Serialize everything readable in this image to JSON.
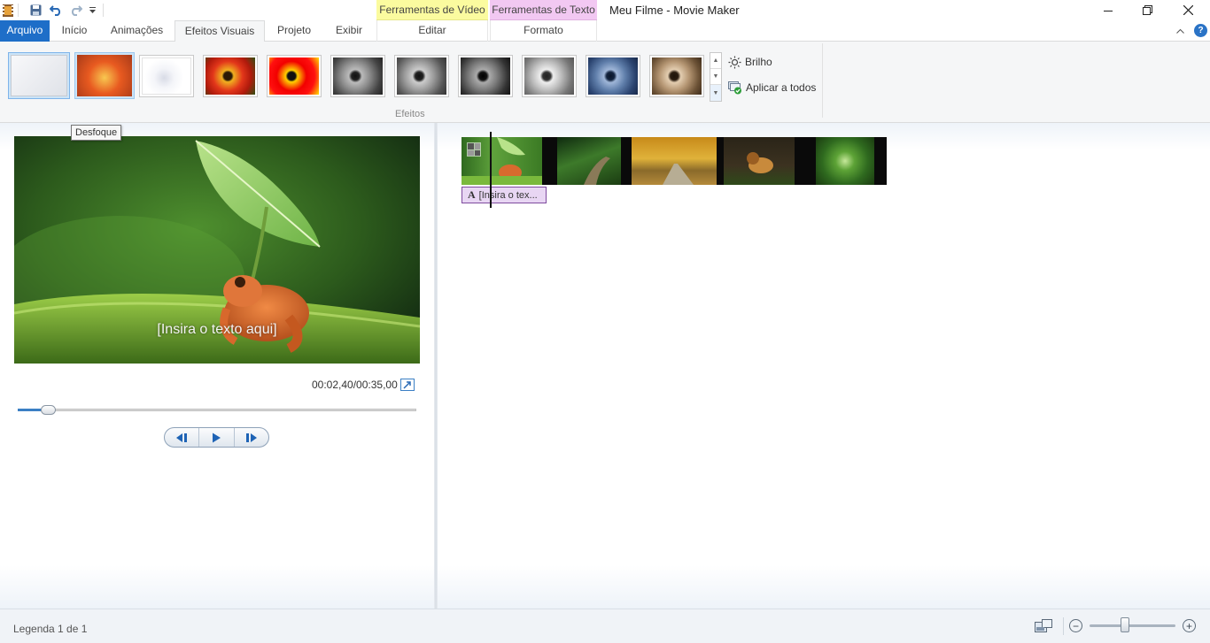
{
  "app": {
    "title": "Meu Filme - Movie Maker"
  },
  "context_tabs": {
    "video_tools": "Ferramentas de Vídeo",
    "text_tools": "Ferramentas de Texto"
  },
  "tabs": [
    {
      "label": "Arquivo"
    },
    {
      "label": "Início"
    },
    {
      "label": "Animações"
    },
    {
      "label": "Efeitos Visuais"
    },
    {
      "label": "Projeto"
    },
    {
      "label": "Exibir"
    },
    {
      "label": "Editar"
    },
    {
      "label": "Formato"
    }
  ],
  "active_tab": "Efeitos Visuais",
  "ribbon": {
    "group_label": "Efeitos",
    "brightness_label": "Brilho",
    "apply_all_label": "Aplicar a todos",
    "selected_effect_index": 0
  },
  "tooltip": "Desfoque",
  "preview": {
    "overlay_text": "[Insira o texto aqui]",
    "timecode": "00:02,40/00:35,00",
    "progress_fraction": 0.069
  },
  "storyboard": {
    "caption_label": "[Insira o tex...",
    "caption_icon": "A"
  },
  "status": {
    "text": "Legenda 1 de 1",
    "zoom_fraction": 0.4
  },
  "colors": {
    "file_tab": "#1e6ec8",
    "video_tools": "#fbfb9f",
    "text_tools": "#f2c8f2",
    "caption_block": "#e8d6f3"
  },
  "icons": [
    "app-icon",
    "save-icon",
    "undo-icon",
    "redo-icon",
    "customize-icon",
    "minimize-icon",
    "restore-icon",
    "close-icon",
    "collapse-ribbon-icon",
    "help-icon",
    "sun-icon",
    "apply-all-icon",
    "fullscreen-icon",
    "previous-frame-icon",
    "play-icon",
    "next-frame-icon",
    "thumbnail-size-icon",
    "zoom-out-icon",
    "zoom-in-icon"
  ]
}
